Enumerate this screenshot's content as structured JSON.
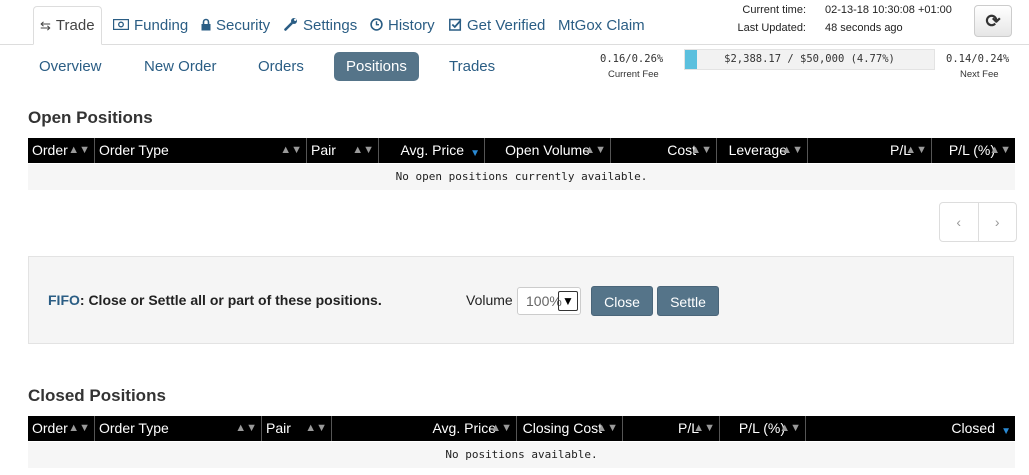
{
  "nav": {
    "tabs": [
      {
        "label": "Trade",
        "icon": "exchange-icon"
      },
      {
        "label": "Funding",
        "icon": "money-icon"
      },
      {
        "label": "Security",
        "icon": "lock-icon"
      },
      {
        "label": "Settings",
        "icon": "wrench-icon"
      },
      {
        "label": "History",
        "icon": "clock-icon"
      },
      {
        "label": "Get Verified",
        "icon": "check-square-icon"
      },
      {
        "label": "MtGox Claim"
      }
    ]
  },
  "status": {
    "current_time_label": "Current time:",
    "current_time": "02-13-18 10:30:08 +01:00",
    "last_updated_label": "Last Updated:",
    "last_updated": "48 seconds ago"
  },
  "subnav": [
    "Overview",
    "New Order",
    "Orders",
    "Positions",
    "Trades"
  ],
  "fees": {
    "current_fee": "0.16/0.26%",
    "current_fee_caption": "Current Fee",
    "volume_text": "$2,388.17 / $50,000 (4.77%)",
    "volume_progress": 0.0477,
    "next_fee": "0.14/0.24%",
    "next_fee_caption": "Next Fee",
    "bar_color": "#5bc0de"
  },
  "open_positions": {
    "title": "Open Positions",
    "columns": [
      "Order",
      "Order Type",
      "Pair",
      "Avg. Price",
      "Open Volume",
      "Cost",
      "Leverage",
      "P/L",
      "P/L (%)"
    ],
    "empty_message": "No open positions currently available."
  },
  "pager": {
    "prev": "‹",
    "next": "›"
  },
  "fifo": {
    "highlight": "FIFO",
    "text": ": Close or Settle all or part of these positions.",
    "volume_label": "Volume",
    "volume_value": "100%",
    "close_label": "Close",
    "settle_label": "Settle",
    "button_color": "#557489"
  },
  "closed_positions": {
    "title": "Closed Positions",
    "columns": [
      "Order",
      "Order Type",
      "Pair",
      "Avg. Price",
      "Closing Cost",
      "P/L",
      "P/L (%)",
      "Closed"
    ],
    "empty_message": "No positions available."
  }
}
